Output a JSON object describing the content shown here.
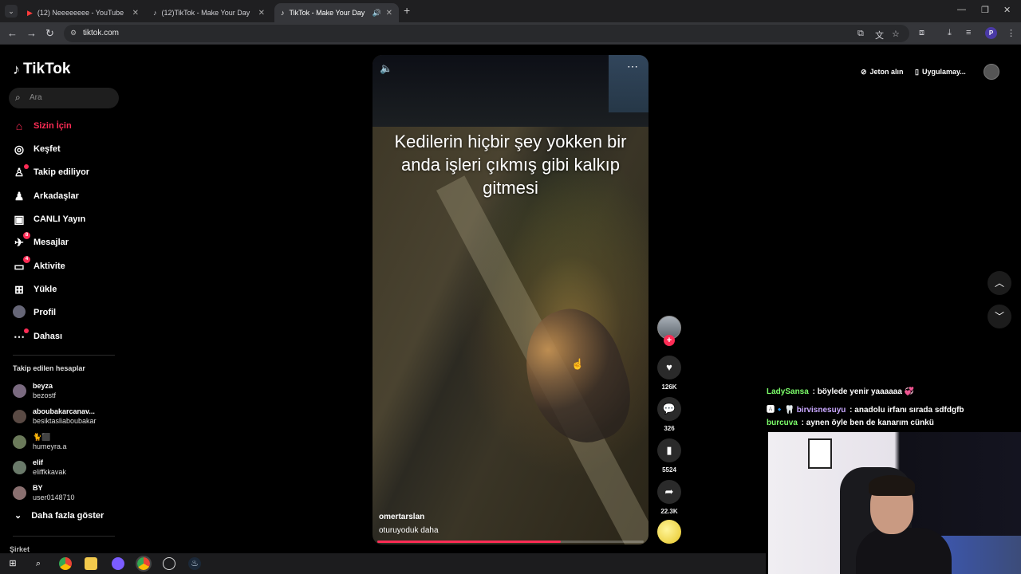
{
  "browser": {
    "tabs": [
      {
        "title": "(12) Neeeeeeee - YouTube",
        "icon": "youtube-icon"
      },
      {
        "title": "(12)TikTok - Make Your Day",
        "icon": "tiktok-icon"
      },
      {
        "title": "TikTok - Make Your Day",
        "icon": "tiktok-icon"
      }
    ],
    "url": "tiktok.com",
    "profile_initial": "P"
  },
  "tiktok": {
    "logo": "TikTok",
    "search_placeholder": "Ara",
    "menu": [
      {
        "label": "Sizin İçin",
        "icon": "home-icon",
        "active": true
      },
      {
        "label": "Keşfet",
        "icon": "compass-icon"
      },
      {
        "label": "Takip ediliyor",
        "icon": "following-icon",
        "dot": true
      },
      {
        "label": "Arkadaşlar",
        "icon": "friends-icon"
      },
      {
        "label": "CANLI Yayın",
        "icon": "live-icon"
      },
      {
        "label": "Mesajlar",
        "icon": "messages-icon",
        "badge": "8"
      },
      {
        "label": "Aktivite",
        "icon": "activity-icon",
        "badge": "4"
      },
      {
        "label": "Yükle",
        "icon": "upload-icon"
      },
      {
        "label": "Profil",
        "icon": "avatar"
      },
      {
        "label": "Dahası",
        "icon": "more-icon",
        "dot": true
      }
    ],
    "following_title": "Takip edilen hesaplar",
    "accounts": [
      {
        "name": "beyza",
        "user": "bezostf"
      },
      {
        "name": "aboubakarcanav...",
        "user": "besiktasliaboubakar"
      },
      {
        "name": "🐈⬛",
        "user": "humeyra.a"
      },
      {
        "name": "elif",
        "user": "eliffkkavak"
      },
      {
        "name": "BY",
        "user": "user0148710"
      }
    ],
    "show_more": "Daha fazla göster",
    "company": "Şirket",
    "top": {
      "coins": "Jeton alın",
      "app": "Uygulamay..."
    }
  },
  "video": {
    "caption": "Kedilerin hiçbir şey yokken bir anda işleri çıkmış gibi kalkıp gitmesi",
    "author": "omertarslan",
    "description": "oturuyoduk daha",
    "progress": 0.69,
    "likes": "126K",
    "comments": "326",
    "saves": "5524",
    "shares": "22.3K"
  },
  "chat": [
    {
      "user": "LadySansa",
      "user_color": "#7dff6b",
      "message": " : böylede yenir yaaaaaa 💞"
    },
    {
      "user": "birvisnesuyu",
      "user_color": "#c9a8ff",
      "prefix": "🅰🔹🦷 ",
      "message": " : anadolu irfanı sırada sdfdgfb"
    },
    {
      "user": "burcuva",
      "user_color": "#7dff6b",
      "message": " : aynen öyle ben de kanarım cünkü"
    }
  ],
  "colors": {
    "accent": "#fe2c55",
    "background": "#000000"
  }
}
